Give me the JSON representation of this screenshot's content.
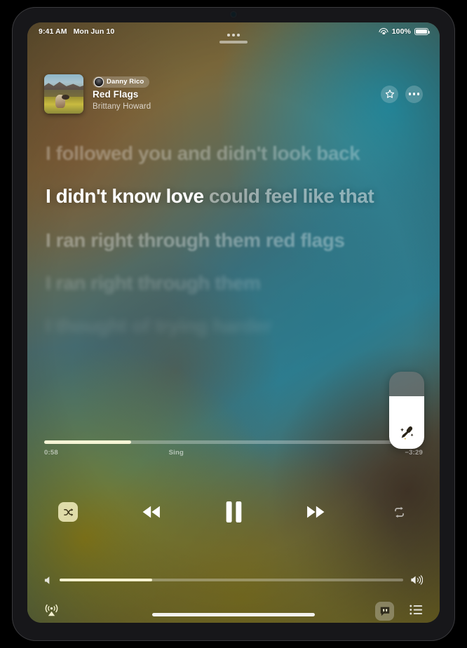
{
  "status_bar": {
    "time": "9:41 AM",
    "date": "Mon Jun 10",
    "battery_percent": "100%",
    "wifi_icon": "wifi-icon",
    "battery_icon": "battery-icon"
  },
  "multitask": {
    "icon": "multitasking-dots-icon",
    "handle": "grabber-handle"
  },
  "now_playing": {
    "artwork_alt": "album-artwork",
    "dj_badge": "Danny Rico",
    "title": "Red Flags",
    "artist": "Brittany Howard",
    "star_icon": "star-icon",
    "more_icon": "more-ellipsis-icon"
  },
  "lyrics": {
    "lines": [
      {
        "text": "I followed you and didn't look back",
        "state": "past"
      },
      {
        "text": "I didn't know love could feel like that",
        "state": "active",
        "sung": "I didn't know love ",
        "unsung": "could feel like that"
      },
      {
        "text": "I ran right through them red flags",
        "state": "next"
      },
      {
        "text": "I ran right through them",
        "state": "future"
      },
      {
        "text": "I thought of trying harder",
        "state": "faded"
      }
    ]
  },
  "sing_slider": {
    "name": "sing-volume-slider",
    "level_percent": 68,
    "icon": "microphone-sparkle-icon"
  },
  "playback": {
    "elapsed": "0:58",
    "remaining": "−3:29",
    "mode_label": "Sing",
    "progress_percent": 23
  },
  "transport": {
    "shuffle": {
      "label": "Shuffle",
      "icon": "shuffle-icon",
      "active": true
    },
    "rewind": {
      "label": "Rewind",
      "icon": "rewind-icon"
    },
    "pause": {
      "label": "Pause",
      "icon": "pause-icon"
    },
    "forward": {
      "label": "Fast Forward",
      "icon": "fast-forward-icon"
    },
    "repeat": {
      "label": "Repeat",
      "icon": "repeat-icon",
      "active": false
    }
  },
  "volume": {
    "level_percent": 27,
    "min_icon": "speaker-low-icon",
    "max_icon": "speaker-high-icon"
  },
  "bottom_bar": {
    "airplay": {
      "label": "AirPlay",
      "icon": "airplay-icon"
    },
    "lyrics_toggle": {
      "label": "Lyrics",
      "icon": "lyrics-quote-icon",
      "active": true
    },
    "queue": {
      "label": "Playing Next",
      "icon": "queue-list-icon"
    }
  },
  "colors": {
    "accent_cream": "#fffcdc",
    "teal": "#2a8ea8",
    "olive": "#857818"
  }
}
